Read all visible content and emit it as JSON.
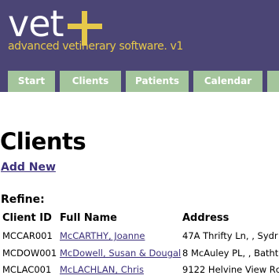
{
  "logo": {
    "word": "vet",
    "tagline": "advanced vetinerary software. v1"
  },
  "nav": {
    "tabs": [
      {
        "label": "Start"
      },
      {
        "label": "Clients"
      },
      {
        "label": "Patients"
      },
      {
        "label": "Calendar"
      }
    ]
  },
  "page": {
    "title": "Clients",
    "add_new": "Add New",
    "refine": "Refine:"
  },
  "table": {
    "headers": [
      "Client ID",
      "Full Name",
      "Address"
    ],
    "rows": [
      {
        "id": "MCCAR001",
        "name": "McCARTHY, Joanne",
        "address": "47A Thrifty Ln, , Sydr"
      },
      {
        "id": "MCDOW001",
        "name": "McDowell, Susan & Dougal",
        "address": "8 McAuley PL, , Batht"
      },
      {
        "id": "MCLAC001",
        "name": "McLACHLAN, Chris",
        "address": "9122 Helvine View Rc"
      }
    ]
  },
  "colors": {
    "header_bg": "#4b4575",
    "tab_bg": "#a4c59c",
    "accent": "#e6c84a",
    "link": "#3b2f7a"
  }
}
